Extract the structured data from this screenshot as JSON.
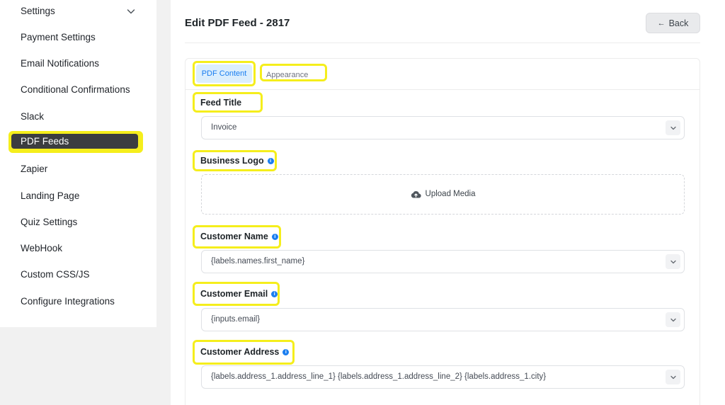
{
  "sidebar": {
    "items": [
      {
        "label": "Settings"
      },
      {
        "label": "Payment Settings"
      },
      {
        "label": "Email Notifications"
      },
      {
        "label": "Conditional Confirmations"
      },
      {
        "label": "Slack"
      },
      {
        "label": "PDF Feeds",
        "active": true
      },
      {
        "label": "Zapier"
      },
      {
        "label": "Landing Page"
      },
      {
        "label": "Quiz Settings"
      },
      {
        "label": "WebHook"
      },
      {
        "label": "Custom CSS/JS"
      },
      {
        "label": "Configure Integrations"
      }
    ]
  },
  "header": {
    "title": "Edit PDF Feed - 2817",
    "back_label": "Back",
    "back_arrow": "←"
  },
  "tabs": [
    {
      "label": "PDF Content",
      "active": true
    },
    {
      "label": "Appearance",
      "active": false
    }
  ],
  "fields": {
    "feed_title": {
      "label": "Feed Title",
      "value": "Invoice"
    },
    "business_logo": {
      "label": "Business Logo",
      "upload_label": "Upload Media"
    },
    "customer_name": {
      "label": "Customer Name",
      "value": "{labels.names.first_name}"
    },
    "customer_email": {
      "label": "Customer Email",
      "value": "{inputs.email}"
    },
    "customer_address": {
      "label": "Customer Address",
      "value": "{labels.address_1.address_line_1} {labels.address_1.address_line_2} {labels.address_1.city}"
    }
  },
  "icons": {
    "info": "info-icon",
    "chevron": "chevron-down-icon",
    "upload": "cloud-upload-icon"
  },
  "colors": {
    "highlight": "#f5ee1c",
    "accent": "#1a7ef0",
    "active_tab_bg": "#dbeefd",
    "active_nav_bg": "#3b3d40"
  }
}
